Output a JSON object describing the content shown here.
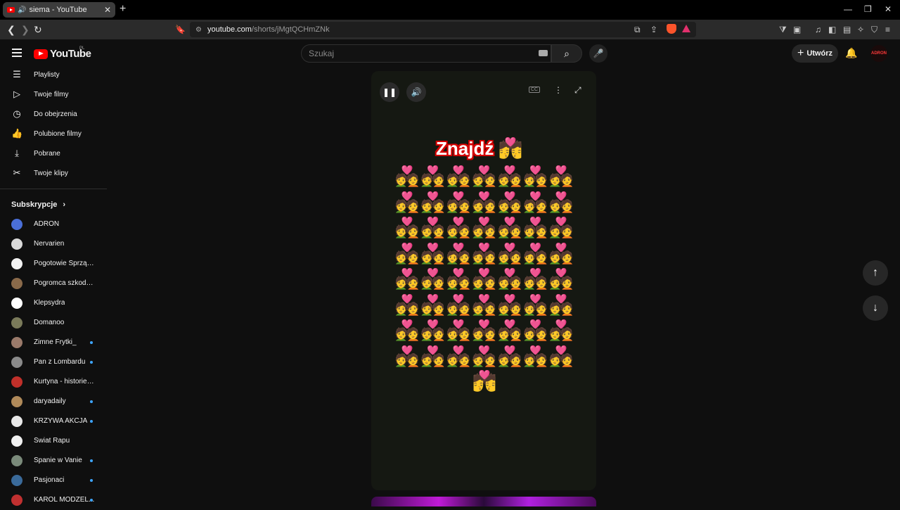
{
  "browser": {
    "tab_title": "siema - YouTube",
    "url_host": "youtube.com",
    "url_path": "/shorts/jMgtQCHmZNk",
    "colors": {
      "tab_active": "#3c3c3c",
      "chrome": "#2b2b2b"
    }
  },
  "masthead": {
    "logo_text": "YouTube",
    "region": "PL",
    "search_placeholder": "Szukaj",
    "create_label": "Utwórz",
    "avatar_text": "ADRON"
  },
  "sidebar": {
    "items": [
      {
        "label": "Playlisty",
        "icon": "playlist-icon"
      },
      {
        "label": "Twoje filmy",
        "icon": "your-videos-icon"
      },
      {
        "label": "Do obejrzenia",
        "icon": "watch-later-icon"
      },
      {
        "label": "Polubione filmy",
        "icon": "liked-icon"
      },
      {
        "label": "Pobrane",
        "icon": "download-icon"
      },
      {
        "label": "Twoje klipy",
        "icon": "clips-icon"
      }
    ],
    "subscriptions_title": "Subskrypcje",
    "subscriptions": [
      {
        "name": "ADRON",
        "color": "#4a6fd8",
        "new": false
      },
      {
        "name": "Nervarien",
        "color": "#d9d9d9",
        "new": false
      },
      {
        "name": "Pogotowie Sprzątaj...",
        "color": "#f2f2f2",
        "new": false
      },
      {
        "name": "Pogromca szkodni...",
        "color": "#8a6a4a",
        "new": false
      },
      {
        "name": "Klepsydra",
        "color": "#ffffff",
        "new": false
      },
      {
        "name": "Domanoo",
        "color": "#7a7a5a",
        "new": false
      },
      {
        "name": "Zimne Frytki_",
        "color": "#9a7a6a",
        "new": true
      },
      {
        "name": "Pan z Lombardu",
        "color": "#8a8a8a",
        "new": true
      },
      {
        "name": "Kurtyna - historie zz...",
        "color": "#c0302a",
        "new": false
      },
      {
        "name": "daryadaily",
        "color": "#b08a5a",
        "new": true
      },
      {
        "name": "KRZYWA AKCJA",
        "color": "#e8e8e8",
        "new": true
      },
      {
        "name": "Świat Rapu",
        "color": "#f0f0f0",
        "new": false
      },
      {
        "name": "Spanie w Vanie",
        "color": "#7a8a7a",
        "new": true
      },
      {
        "name": "Pasjonaci",
        "color": "#3a6a9a",
        "new": true
      },
      {
        "name": "KAROL MODZEL...",
        "color": "#c03030",
        "new": true
      }
    ]
  },
  "short": {
    "title": "Znajdź",
    "emoji": "💑",
    "grid_count": 56,
    "odd_emoji": "💏"
  }
}
